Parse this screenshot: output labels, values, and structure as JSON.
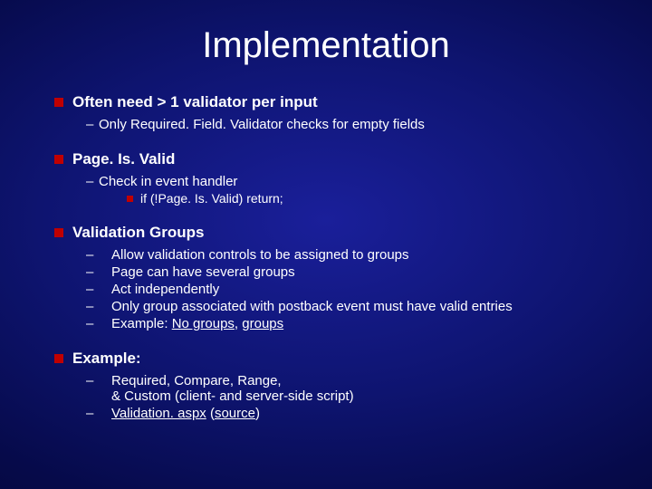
{
  "title": "Implementation",
  "s1": {
    "head": "Often need  > 1 validator per input",
    "sub1": "Only Required. Field. Validator checks for empty fields"
  },
  "s2": {
    "head": "Page. Is. Valid",
    "sub1": "Check in event handler",
    "sub1a": "if (!Page. Is. Valid) return;"
  },
  "s3": {
    "head": "Validation Groups",
    "sub1": "Allow validation controls to be assigned to groups",
    "sub2": "Page can have several groups",
    "sub3": "Act independently",
    "sub4": "Only group associated with postback event must have valid entries",
    "sub5_pre": "Example: ",
    "sub5_link1": "No groups",
    "sub5_sep": ", ",
    "sub5_link2": "groups"
  },
  "s4": {
    "head": "Example:",
    "sub1a": "Required, Compare, Range,",
    "sub1b": "& Custom (client- and server-side script)",
    "sub2_link1": "Validation. aspx",
    "sub2_mid": " (",
    "sub2_link2": "source",
    "sub2_end": ")"
  }
}
